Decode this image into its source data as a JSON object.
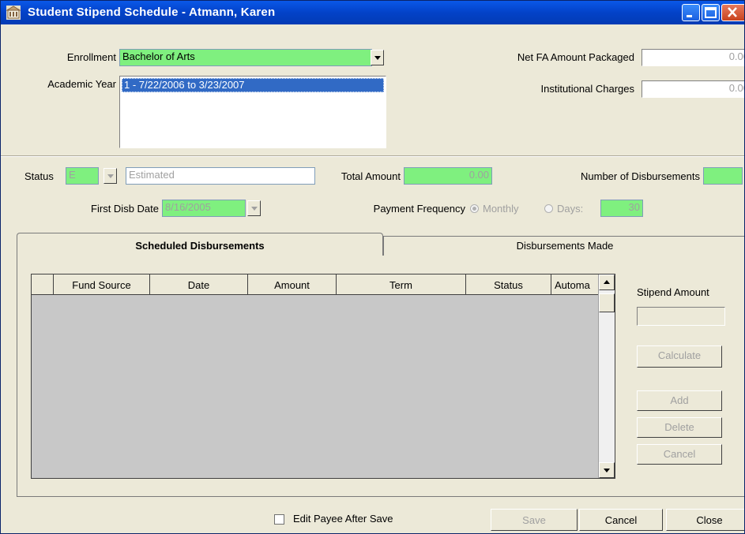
{
  "window": {
    "title": "Student Stipend Schedule - Atmann, Karen",
    "app_icon": "building-icon",
    "controls": [
      "minimize-icon",
      "maximize-icon",
      "close-icon"
    ]
  },
  "enrollment": {
    "label": "Enrollment",
    "value": "Bachelor of Arts"
  },
  "academic_year": {
    "label": "Academic Year",
    "items": [
      "1 - 7/22/2006 to 3/23/2007"
    ]
  },
  "net_fa": {
    "label": "Net FA Amount Packaged",
    "value": "0.00"
  },
  "institutional_charges": {
    "label": "Institutional Charges",
    "value": "0.00"
  },
  "status": {
    "label": "Status",
    "code": "E",
    "description": "Estimated"
  },
  "total_amount": {
    "label": "Total Amount",
    "value": "0.00"
  },
  "num_disbursements": {
    "label": "Number of Disbursements",
    "value": ""
  },
  "first_disb_date": {
    "label": "First Disb Date",
    "value": "8/16/2005"
  },
  "payment_frequency": {
    "label": "Payment Frequency",
    "monthly_label": "Monthly",
    "days_label": "Days:",
    "days_value": "30",
    "selected": "Monthly"
  },
  "tabs": {
    "scheduled": "Scheduled Disbursements",
    "made": "Disbursements Made"
  },
  "grid": {
    "columns": [
      "",
      "Fund Source",
      "Date",
      "Amount",
      "Term",
      "Status",
      "Automa"
    ],
    "rows": []
  },
  "stipend": {
    "label": "Stipend Amount",
    "value": "",
    "calculate": "Calculate",
    "add": "Add",
    "delete": "Delete",
    "cancel": "Cancel"
  },
  "footer": {
    "edit_payee_label": "Edit Payee After Save",
    "edit_payee_checked": false,
    "save": "Save",
    "cancel": "Cancel",
    "close": "Close"
  },
  "colors": {
    "title_bar": "#0342c8",
    "required_field": "#7ff07f",
    "selection": "#316ac5"
  }
}
